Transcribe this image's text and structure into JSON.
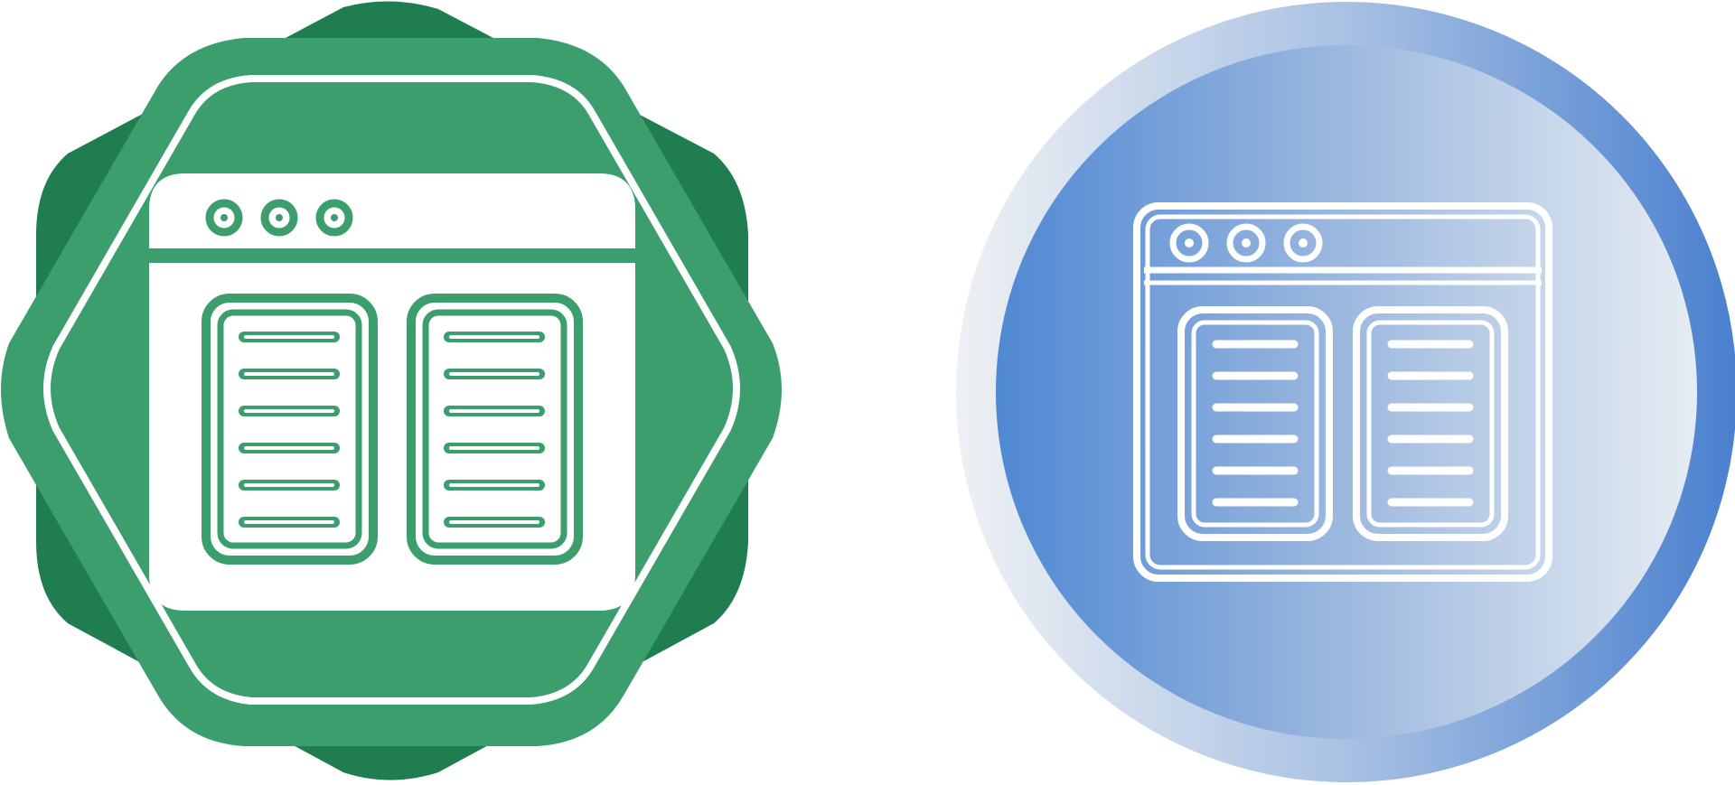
{
  "icons": [
    {
      "name": "browser-two-column-icon",
      "variant": "flat",
      "colors": {
        "outer_badge": "#1f7d4f",
        "inner_badge": "#3d9e6d",
        "content": "#ffffff",
        "line_stroke": "#3d9e6d"
      }
    },
    {
      "name": "browser-two-column-icon",
      "variant": "gradient",
      "colors": {
        "outer_light": "#e7ecf2",
        "outer_dark": "#4a7fcf",
        "inner_light": "#c9d8ec",
        "inner_dark": "#5288d4",
        "line_stroke": "#ffffff"
      }
    }
  ]
}
